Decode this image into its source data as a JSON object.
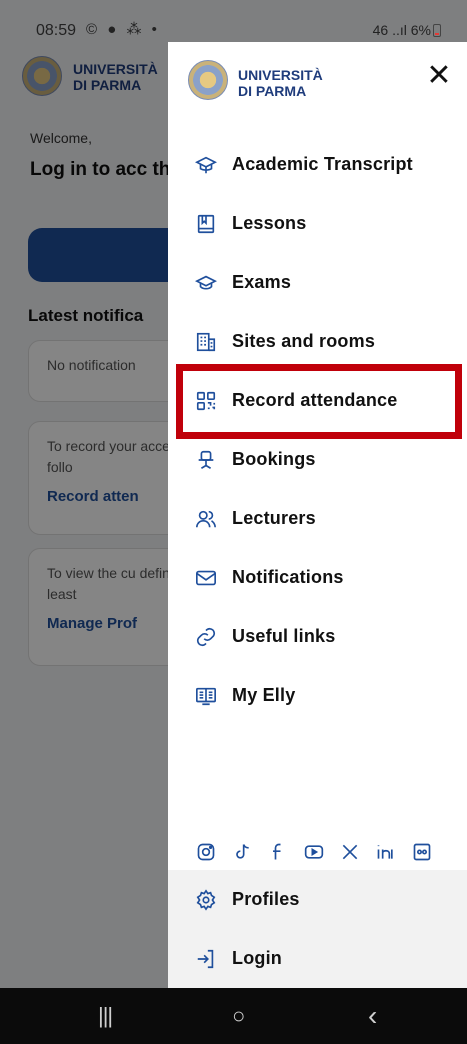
{
  "status_bar": {
    "time": "08:59",
    "left_icons": "© ● ⁂ •",
    "right_text": "46 ..ıl 6%"
  },
  "background_app": {
    "logo_text_line1": "UNIVERSITÀ",
    "logo_text_line2": "DI PARMA",
    "welcome": "Welcome,",
    "heading": "Log in to acc the App",
    "latest_notifications": "Latest notifica",
    "card1_text": "No notification",
    "card2_text": "To record your access the follo",
    "card2_link": "Record atten",
    "card3_text": "To view the cu define at least",
    "card3_link": "Manage Prof"
  },
  "drawer": {
    "logo_text_line1": "UNIVERSITÀ",
    "logo_text_line2": "DI PARMA",
    "close_glyph": "✕",
    "menu_items": [
      {
        "label": "Academic Transcript",
        "icon": "mortarboard-icon"
      },
      {
        "label": "Lessons",
        "icon": "book-icon"
      },
      {
        "label": "Exams",
        "icon": "graduation-cap-icon"
      },
      {
        "label": "Sites and rooms",
        "icon": "building-icon"
      },
      {
        "label": "Record attendance",
        "icon": "qr-code-icon"
      },
      {
        "label": "Bookings",
        "icon": "desk-chair-icon"
      },
      {
        "label": "Lecturers",
        "icon": "people-icon"
      },
      {
        "label": "Notifications",
        "icon": "envelope-icon"
      },
      {
        "label": "Useful links",
        "icon": "link-icon"
      },
      {
        "label": "My Elly",
        "icon": "elly-book-icon"
      }
    ],
    "social_icons": [
      "instagram-icon",
      "tiktok-icon",
      "facebook-icon",
      "youtube-icon",
      "x-icon",
      "linkedin-icon",
      "flickr-icon"
    ],
    "footer_items": [
      {
        "label": "Profiles",
        "icon": "gear-icon"
      },
      {
        "label": "Login",
        "icon": "login-icon"
      }
    ]
  },
  "colors": {
    "brand_blue": "#1f4f9c",
    "logo_text": "#1f3c7c",
    "highlight_red": "#c0000a"
  },
  "nav_bar": {
    "recents": "|||",
    "home": "○",
    "back": "‹"
  }
}
